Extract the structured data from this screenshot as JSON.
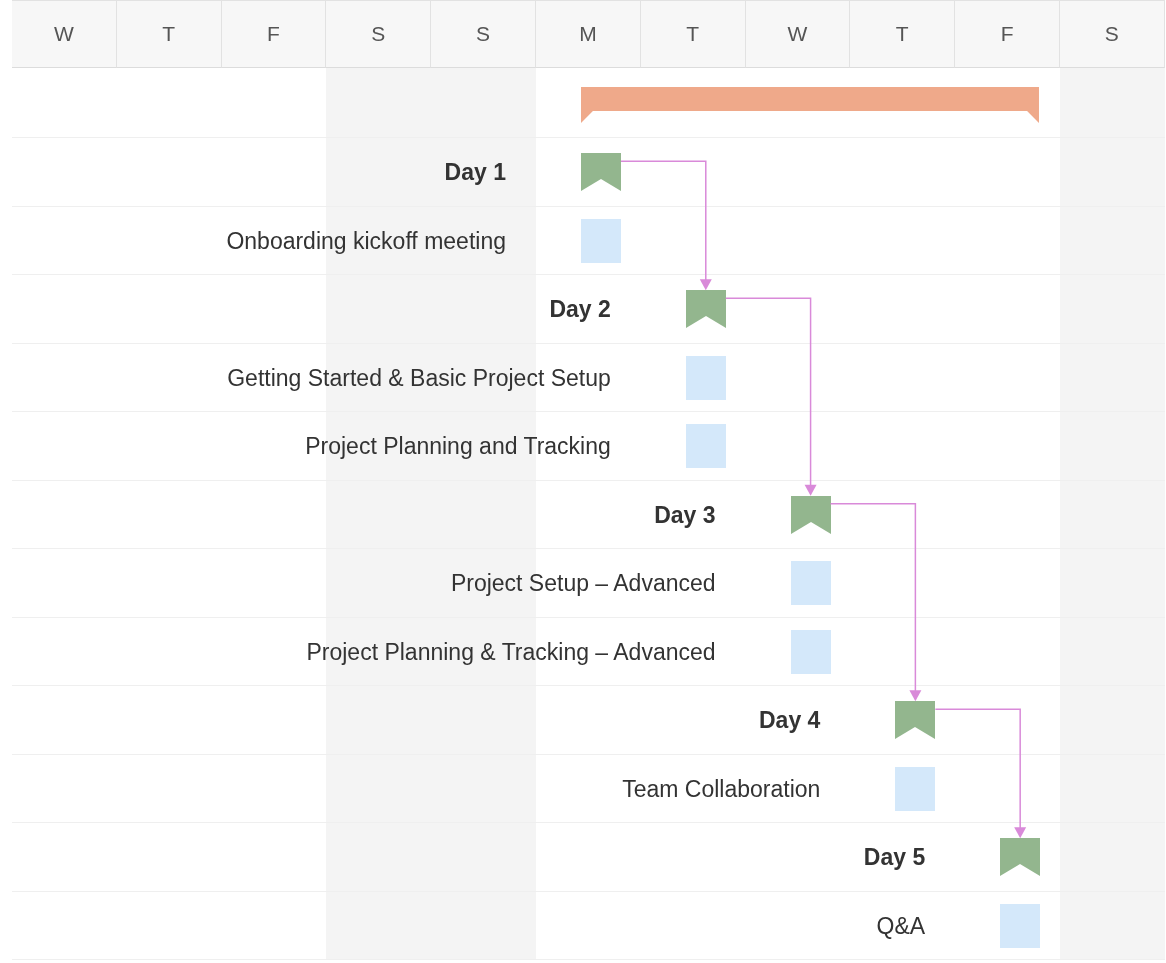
{
  "timeline": {
    "columns": [
      {
        "label": "W",
        "weekend": false
      },
      {
        "label": "T",
        "weekend": false
      },
      {
        "label": "F",
        "weekend": false
      },
      {
        "label": "S",
        "weekend": true
      },
      {
        "label": "S",
        "weekend": true
      },
      {
        "label": "M",
        "weekend": false,
        "plan_day": {
          "label": "Day 1",
          "tasks": [
            {
              "label": "Onboarding kickoff meeting"
            }
          ]
        }
      },
      {
        "label": "T",
        "weekend": false,
        "plan_day": {
          "label": "Day 2",
          "tasks": [
            {
              "label": "Getting Started & Basic Project Setup"
            },
            {
              "label": "Project Planning and Tracking"
            }
          ]
        }
      },
      {
        "label": "W",
        "weekend": false,
        "plan_day": {
          "label": "Day 3",
          "tasks": [
            {
              "label": "Project Setup – Advanced"
            },
            {
              "label": "Project Planning & Tracking – Advanced"
            }
          ]
        }
      },
      {
        "label": "T",
        "weekend": false,
        "plan_day": {
          "label": "Day 4",
          "tasks": [
            {
              "label": "Team Collaboration"
            }
          ]
        }
      },
      {
        "label": "F",
        "weekend": false,
        "plan_day": {
          "label": "Day 5",
          "tasks": [
            {
              "label": "Q&A"
            }
          ]
        }
      },
      {
        "label": "S",
        "weekend": true
      }
    ]
  }
}
